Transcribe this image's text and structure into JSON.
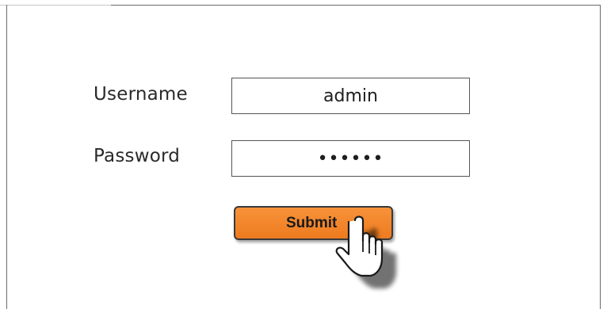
{
  "form": {
    "username_label": "Username",
    "password_label": "Password",
    "username_value": "admin",
    "password_value": "••••••",
    "submit_label": "Submit"
  },
  "colors": {
    "button_fill": "#f08227",
    "frame": "#6a6a6a",
    "text": "#2a2a2a"
  },
  "icons": {
    "pointer": "hand-pointer-icon"
  }
}
